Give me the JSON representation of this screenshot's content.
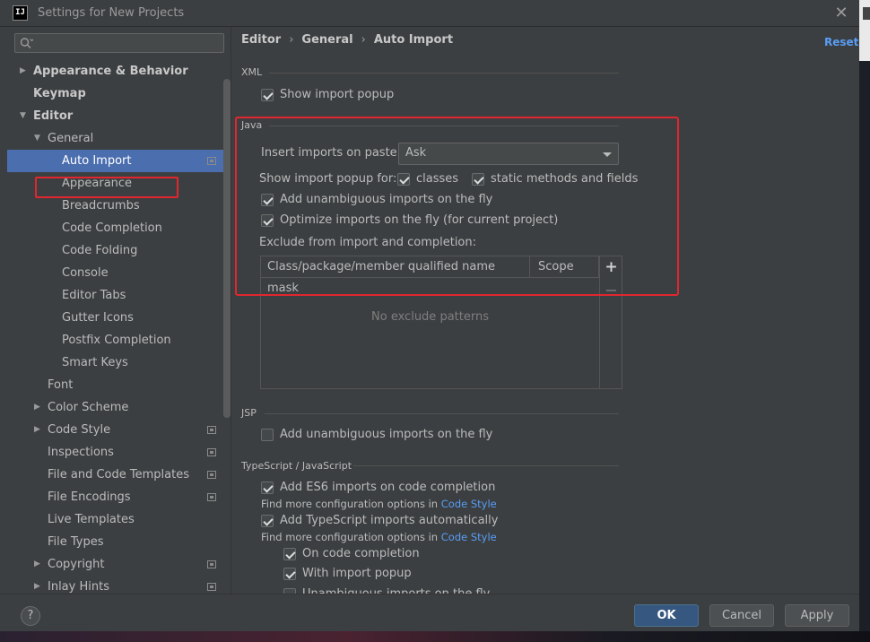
{
  "window": {
    "title": "Settings for New Projects",
    "logo_text": "IJ"
  },
  "search": {
    "placeholder": ""
  },
  "sidebar": {
    "items": [
      {
        "label": "Appearance & Behavior",
        "level": 0,
        "expandable": true,
        "expanded": false,
        "bold": true
      },
      {
        "label": "Keymap",
        "level": 0,
        "expandable": false,
        "bold": true
      },
      {
        "label": "Editor",
        "level": 0,
        "expandable": true,
        "expanded": true,
        "bold": true
      },
      {
        "label": "General",
        "level": 1,
        "expandable": true,
        "expanded": true
      },
      {
        "label": "Auto Import",
        "level": 2,
        "selected": true,
        "project_icon": true
      },
      {
        "label": "Appearance",
        "level": 2
      },
      {
        "label": "Breadcrumbs",
        "level": 2
      },
      {
        "label": "Code Completion",
        "level": 2
      },
      {
        "label": "Code Folding",
        "level": 2
      },
      {
        "label": "Console",
        "level": 2
      },
      {
        "label": "Editor Tabs",
        "level": 2
      },
      {
        "label": "Gutter Icons",
        "level": 2
      },
      {
        "label": "Postfix Completion",
        "level": 2
      },
      {
        "label": "Smart Keys",
        "level": 2
      },
      {
        "label": "Font",
        "level": 1
      },
      {
        "label": "Color Scheme",
        "level": 1,
        "expandable": true,
        "expanded": false
      },
      {
        "label": "Code Style",
        "level": 1,
        "expandable": true,
        "expanded": false,
        "project_icon": true
      },
      {
        "label": "Inspections",
        "level": 1,
        "project_icon": true
      },
      {
        "label": "File and Code Templates",
        "level": 1,
        "project_icon": true
      },
      {
        "label": "File Encodings",
        "level": 1,
        "project_icon": true
      },
      {
        "label": "Live Templates",
        "level": 1
      },
      {
        "label": "File Types",
        "level": 1
      },
      {
        "label": "Copyright",
        "level": 1,
        "expandable": true,
        "expanded": false,
        "project_icon": true
      },
      {
        "label": "Inlay Hints",
        "level": 1,
        "expandable": true,
        "expanded": false,
        "project_icon": true
      }
    ]
  },
  "breadcrumb": {
    "parts": [
      "Editor",
      "General",
      "Auto Import"
    ],
    "separator": "›"
  },
  "reset_label": "Reset",
  "xml": {
    "title": "XML",
    "show_import_popup": {
      "label": "Show import popup",
      "checked": true
    }
  },
  "java": {
    "title": "Java",
    "insert_imports_label": "Insert imports on paste:",
    "insert_imports_value": "Ask",
    "show_popup_for_label": "Show import popup for:",
    "classes": {
      "label": "classes",
      "checked": true
    },
    "static_methods": {
      "label": "static methods and fields",
      "checked": true
    },
    "add_unambiguous": {
      "label": "Add unambiguous imports on the fly",
      "checked": true
    },
    "optimize_imports": {
      "label": "Optimize imports on the fly (for current project)",
      "checked": true
    },
    "exclude_label": "Exclude from import and completion:",
    "table": {
      "columns": [
        "Class/package/member qualified name mask",
        "Scope"
      ],
      "empty_text": "No exclude patterns",
      "add_symbol": "+"
    }
  },
  "jsp": {
    "title": "JSP",
    "add_unambiguous": {
      "label": "Add unambiguous imports on the fly",
      "checked": false
    }
  },
  "typescript": {
    "title": "TypeScript / JavaScript",
    "es6": {
      "label": "Add ES6 imports on code completion",
      "checked": true
    },
    "hint1_text": "Find more configuration options in ",
    "hint1_link": "Code Style",
    "ts_auto": {
      "label": "Add TypeScript imports automatically",
      "checked": true
    },
    "hint2_text": "Find more configuration options in ",
    "hint2_link": "Code Style",
    "on_completion": {
      "label": "On code completion",
      "checked": true
    },
    "with_popup": {
      "label": "With import popup",
      "checked": true
    },
    "unambiguous_partial": {
      "label": "Unambiguous imports on the fly",
      "checked": false
    }
  },
  "footer": {
    "help_label": "?",
    "ok_label": "OK",
    "cancel_label": "Cancel",
    "apply_label": "Apply"
  },
  "colors": {
    "selection": "#4b6eaf",
    "link": "#589df6",
    "annotation_red": "#e0272f",
    "primary_button": "#365880"
  }
}
